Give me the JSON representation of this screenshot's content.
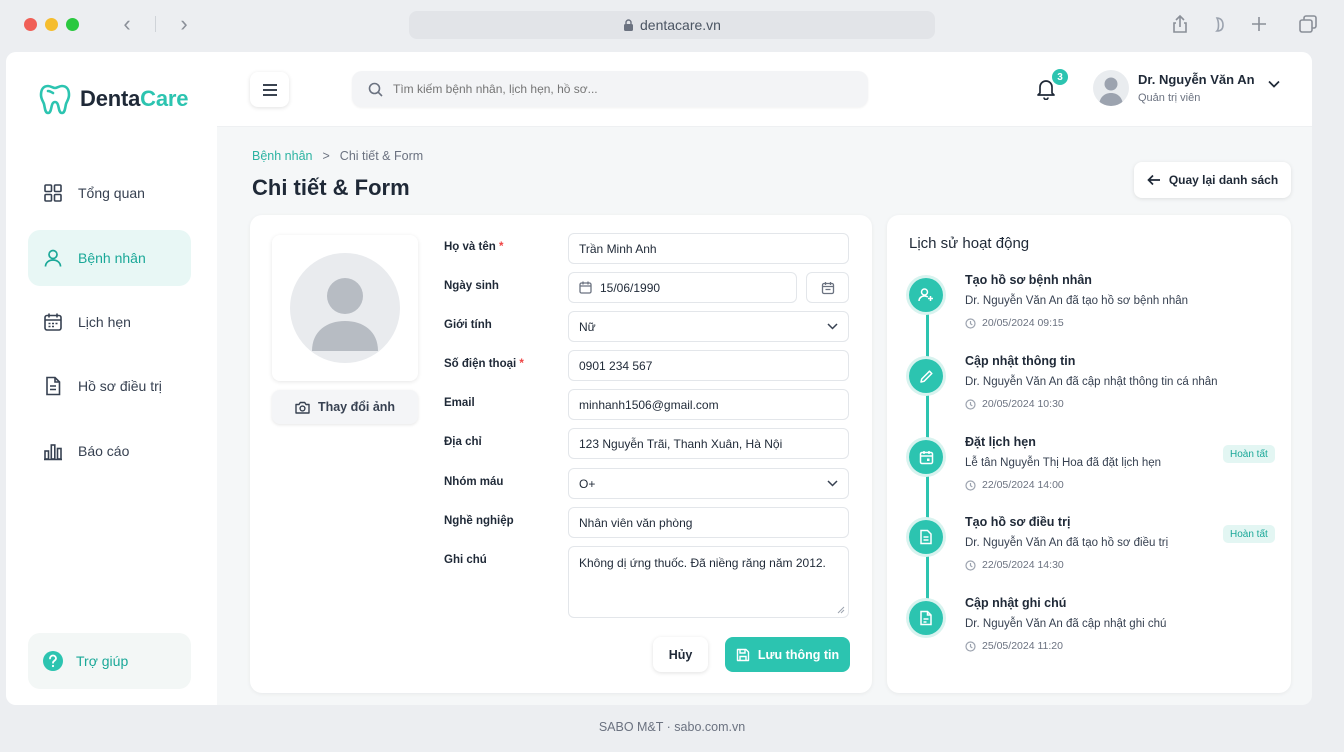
{
  "browser": {
    "url": "dentacare.vn"
  },
  "brand": {
    "part1": "Denta",
    "part2": "Care"
  },
  "sidebar": {
    "items": [
      {
        "label": "Tổng quan",
        "icon": "grid-icon"
      },
      {
        "label": "Bệnh nhân",
        "icon": "user-icon",
        "active": true
      },
      {
        "label": "Lịch hẹn",
        "icon": "calendar-icon"
      },
      {
        "label": "Hồ sơ điều trị",
        "icon": "document-icon"
      },
      {
        "label": "Báo cáo",
        "icon": "bar-chart-icon"
      }
    ],
    "help": "Trợ giúp"
  },
  "topbar": {
    "search_placeholder": "Tìm kiếm bệnh nhân, lịch hẹn, hồ sơ...",
    "notification_count": "3",
    "user_name": "Dr. Nguyễn Văn An",
    "user_role": "Quản trị viên"
  },
  "breadcrumb": {
    "parent": "Bệnh nhân",
    "separator": ">",
    "current": "Chi tiết & Form"
  },
  "page_title": "Chi tiết & Form",
  "back_button": "Quay lại danh sách",
  "profile": {
    "change_photo": "Thay đổi ảnh"
  },
  "form": {
    "fields": [
      {
        "label": "Họ và tên",
        "required": "*",
        "value": "Trần Minh Anh"
      },
      {
        "label": "Ngày sinh",
        "value": "15/06/1990"
      },
      {
        "label": "Giới tính",
        "value": "Nữ"
      },
      {
        "label": "Số điện thoại",
        "required": "*",
        "value": "0901 234 567"
      },
      {
        "label": "Email",
        "value": "minhanh1506@gmail.com"
      },
      {
        "label": "Địa chỉ",
        "value": "123 Nguyễn Trãi, Thanh Xuân, Hà Nội"
      },
      {
        "label": "Nhóm máu",
        "value": "O+"
      },
      {
        "label": "Nghề nghiệp",
        "value": "Nhân viên văn phòng"
      },
      {
        "label": "Ghi chú",
        "value": "Không dị ứng thuốc. Đã niềng răng năm 2012."
      }
    ],
    "cancel": "Hủy",
    "save": "Lưu thông tin"
  },
  "history": {
    "title": "Lịch sử hoạt động",
    "items": [
      {
        "title": "Tạo hồ sơ bệnh nhân",
        "desc": "Dr. Nguyễn Văn An đã tạo hồ sơ bệnh nhân",
        "time": "20/05/2024 09:15",
        "badge": "",
        "icon": "user-plus-icon"
      },
      {
        "title": "Cập nhật thông tin",
        "desc": "Dr. Nguyễn Văn An đã cập nhật thông tin cá nhân",
        "time": "20/05/2024 10:30",
        "badge": "",
        "icon": "pencil-icon"
      },
      {
        "title": "Đặt lịch hẹn",
        "desc": "Lễ tân Nguyễn Thị Hoa đã đặt lịch hẹn",
        "time": "22/05/2024 14:00",
        "badge": "Hoàn tất",
        "icon": "calendar-icon"
      },
      {
        "title": "Tạo hồ sơ điều trị",
        "desc": "Dr. Nguyễn Văn An đã tạo hồ sơ điều trị",
        "time": "22/05/2024 14:30",
        "badge": "Hoàn tất",
        "icon": "document-icon"
      },
      {
        "title": "Cập nhật ghi chú",
        "desc": "Dr. Nguyễn Văn An đã cập nhật ghi chú",
        "time": "25/05/2024 11:20",
        "badge": "",
        "icon": "note-icon"
      }
    ]
  },
  "footer": {
    "text": "SABO M&T  ·  sabo.com.vn"
  },
  "colors": {
    "accent": "#2cc4b0",
    "accent_light": "#e8f7f5",
    "required": "#ef4444"
  }
}
